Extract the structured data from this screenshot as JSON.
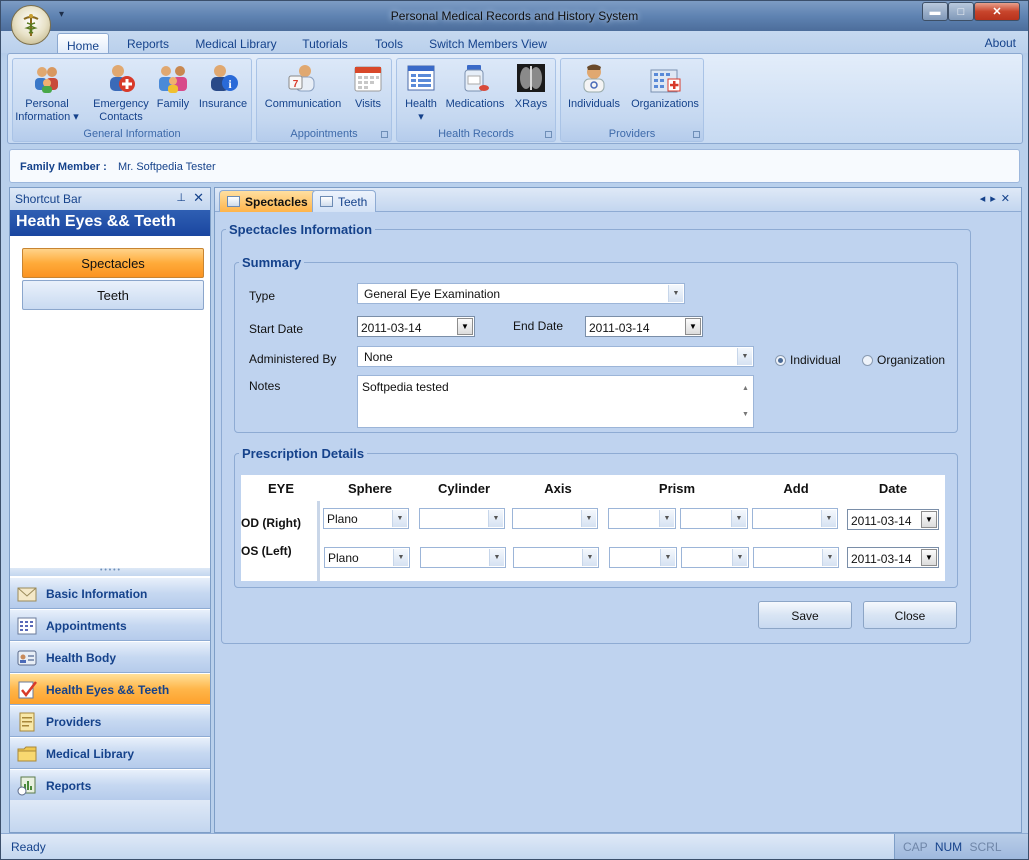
{
  "window": {
    "title": "Personal Medical Records and History System"
  },
  "ribbon": {
    "tabs": [
      "Home",
      "Reports",
      "Medical Library",
      "Tutorials",
      "Tools",
      "Switch Members View"
    ],
    "about": "About",
    "groups": [
      {
        "label": "General Information",
        "buttons": [
          {
            "label1": "Personal",
            "label2": "Information ▾"
          },
          {
            "label1": "Emergency",
            "label2": "Contacts"
          },
          {
            "label1": "Family",
            "label2": ""
          },
          {
            "label1": "Insurance",
            "label2": ""
          }
        ]
      },
      {
        "label": "Appointments",
        "buttons": [
          {
            "label1": "Communication",
            "label2": ""
          },
          {
            "label1": "Visits",
            "label2": ""
          }
        ]
      },
      {
        "label": "Health Records",
        "buttons": [
          {
            "label1": "Health",
            "label2": "▾"
          },
          {
            "label1": "Medications",
            "label2": ""
          },
          {
            "label1": "XRays",
            "label2": ""
          }
        ]
      },
      {
        "label": "Providers",
        "buttons": [
          {
            "label1": "Individuals",
            "label2": ""
          },
          {
            "label1": "Organizations",
            "label2": ""
          }
        ]
      }
    ]
  },
  "member": {
    "label": "Family Member :",
    "value": "Mr. Softpedia Tester"
  },
  "sidebar": {
    "header": "Shortcut Bar",
    "title": "Heath Eyes && Teeth",
    "buttons": [
      "Spectacles",
      "Teeth"
    ],
    "nav": [
      "Basic Information",
      "Appointments",
      "Health Body",
      "Health Eyes && Teeth",
      "Providers",
      "Medical Library",
      "Reports"
    ]
  },
  "doc": {
    "tabs": [
      "Spectacles",
      "Teeth"
    ],
    "frame_title": "Spectacles Information",
    "summary": {
      "legend": "Summary",
      "type_label": "Type",
      "type_value": "General Eye Examination",
      "start_label": "Start Date",
      "start_value": "2011-03-14",
      "end_label": "End Date",
      "end_value": "2011-03-14",
      "admin_label": "Administered By",
      "admin_value": "None",
      "radio_individual": "Individual",
      "radio_organization": "Organization",
      "notes_label": "Notes",
      "notes_value": "Softpedia tested"
    },
    "prescription": {
      "legend": "Prescription Details",
      "headers": [
        "EYE",
        "Sphere",
        "Cylinder",
        "Axis",
        "Prism",
        "Add",
        "Date"
      ],
      "rows": [
        {
          "eye": "OD (Right)",
          "sphere": "Plano",
          "date": "2011-03-14"
        },
        {
          "eye": "OS (Left)",
          "sphere": "Plano",
          "date": "2011-03-14"
        }
      ]
    },
    "save": "Save",
    "close": "Close"
  },
  "status": {
    "text": "Ready",
    "cap": "CAP",
    "num": "NUM",
    "scrl": "SCRL"
  }
}
